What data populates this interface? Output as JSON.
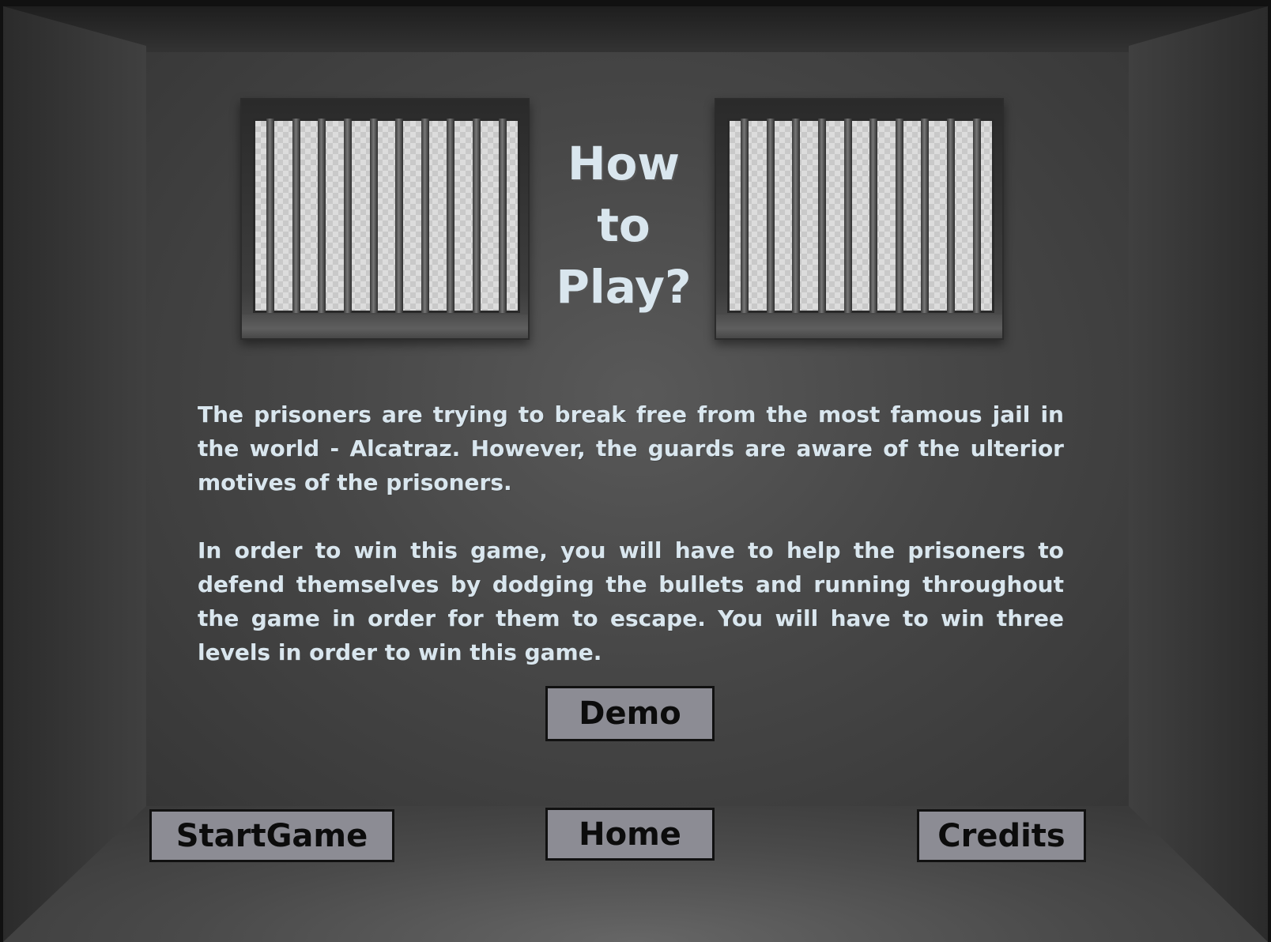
{
  "title": {
    "line1": "How",
    "line2": "to",
    "line3": "Play?"
  },
  "paragraphs": [
    "The prisoners are trying to break free from the most famous jail in the world - Alcatraz. However, the guards are aware of the ulterior motives of the prisoners.",
    "In order to win this game, you will have to help the prisoners to  defend themselves by dodging the bullets and running throughout the game in order for them to escape. You will have to win three levels in order to win this game."
  ],
  "buttons": {
    "demo": "Demo",
    "start_game": "StartGame",
    "home": "Home",
    "credits": "Credits"
  },
  "colors": {
    "text": "#d9e6ee",
    "button_bg": "#8c8c94",
    "button_text": "#0c0c0c",
    "button_border": "#111111"
  }
}
